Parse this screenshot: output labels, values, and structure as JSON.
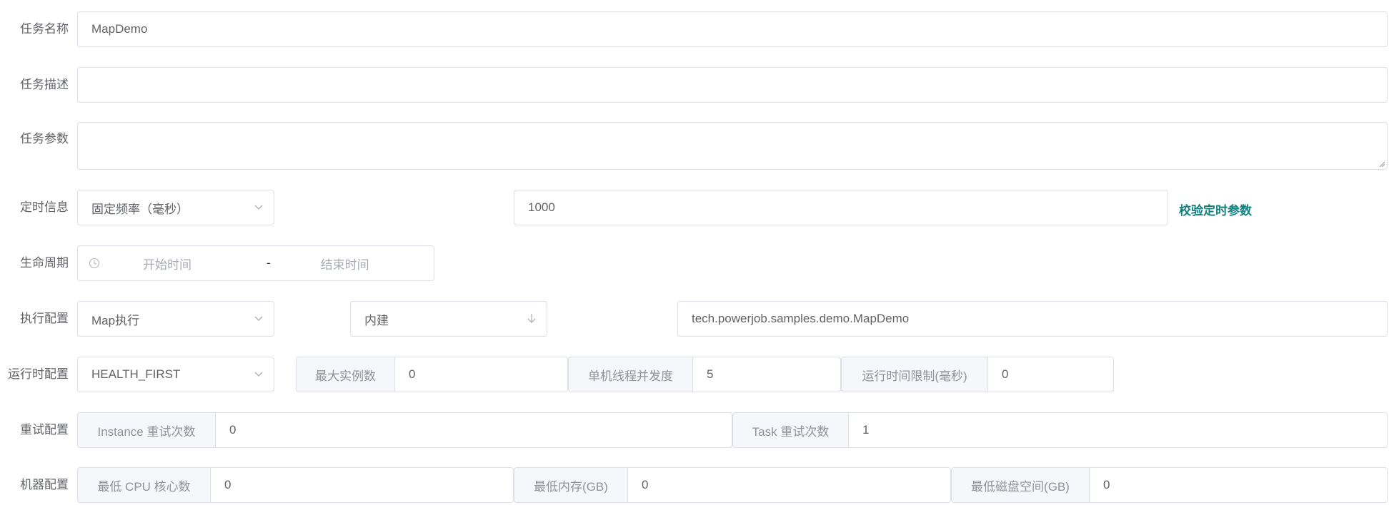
{
  "form": {
    "task_name": {
      "label": "任务名称",
      "value": "MapDemo"
    },
    "task_desc": {
      "label": "任务描述",
      "value": ""
    },
    "task_params": {
      "label": "任务参数",
      "value": ""
    },
    "timing": {
      "label": "定时信息",
      "type_value": "固定频率（毫秒）",
      "expression_value": "1000",
      "validate_link": "校验定时参数"
    },
    "lifecycle": {
      "label": "生命周期",
      "start_placeholder": "开始时间",
      "separator": "-",
      "end_placeholder": "结束时间"
    },
    "execution": {
      "label": "执行配置",
      "execute_type": "Map执行",
      "processor_type": "内建",
      "processor_info": "tech.powerjob.samples.demo.MapDemo"
    },
    "runtime": {
      "label": "运行时配置",
      "dispatch_strategy": "HEALTH_FIRST",
      "max_instance_label": "最大实例数",
      "max_instance_value": "0",
      "concurrency_label": "单机线程并发度",
      "concurrency_value": "5",
      "time_limit_label": "运行时间限制(毫秒)",
      "time_limit_value": "0"
    },
    "retry": {
      "label": "重试配置",
      "instance_retry_label": "Instance 重试次数",
      "instance_retry_value": "0",
      "task_retry_label": "Task 重试次数",
      "task_retry_value": "1"
    },
    "machine": {
      "label": "机器配置",
      "min_cpu_label": "最低 CPU 核心数",
      "min_cpu_value": "0",
      "min_memory_label": "最低内存(GB)",
      "min_memory_value": "0",
      "min_disk_label": "最低磁盘空间(GB)",
      "min_disk_value": "0"
    }
  },
  "icons": {
    "select_arrow": "chevron-down-icon",
    "processor_arrow": "arrow-down-icon",
    "clock": "clock-icon",
    "resize": "resize-handle-icon"
  },
  "colors": {
    "link": "#138080",
    "border": "#dcdfe6",
    "prepend_bg": "#f5f7fa"
  }
}
